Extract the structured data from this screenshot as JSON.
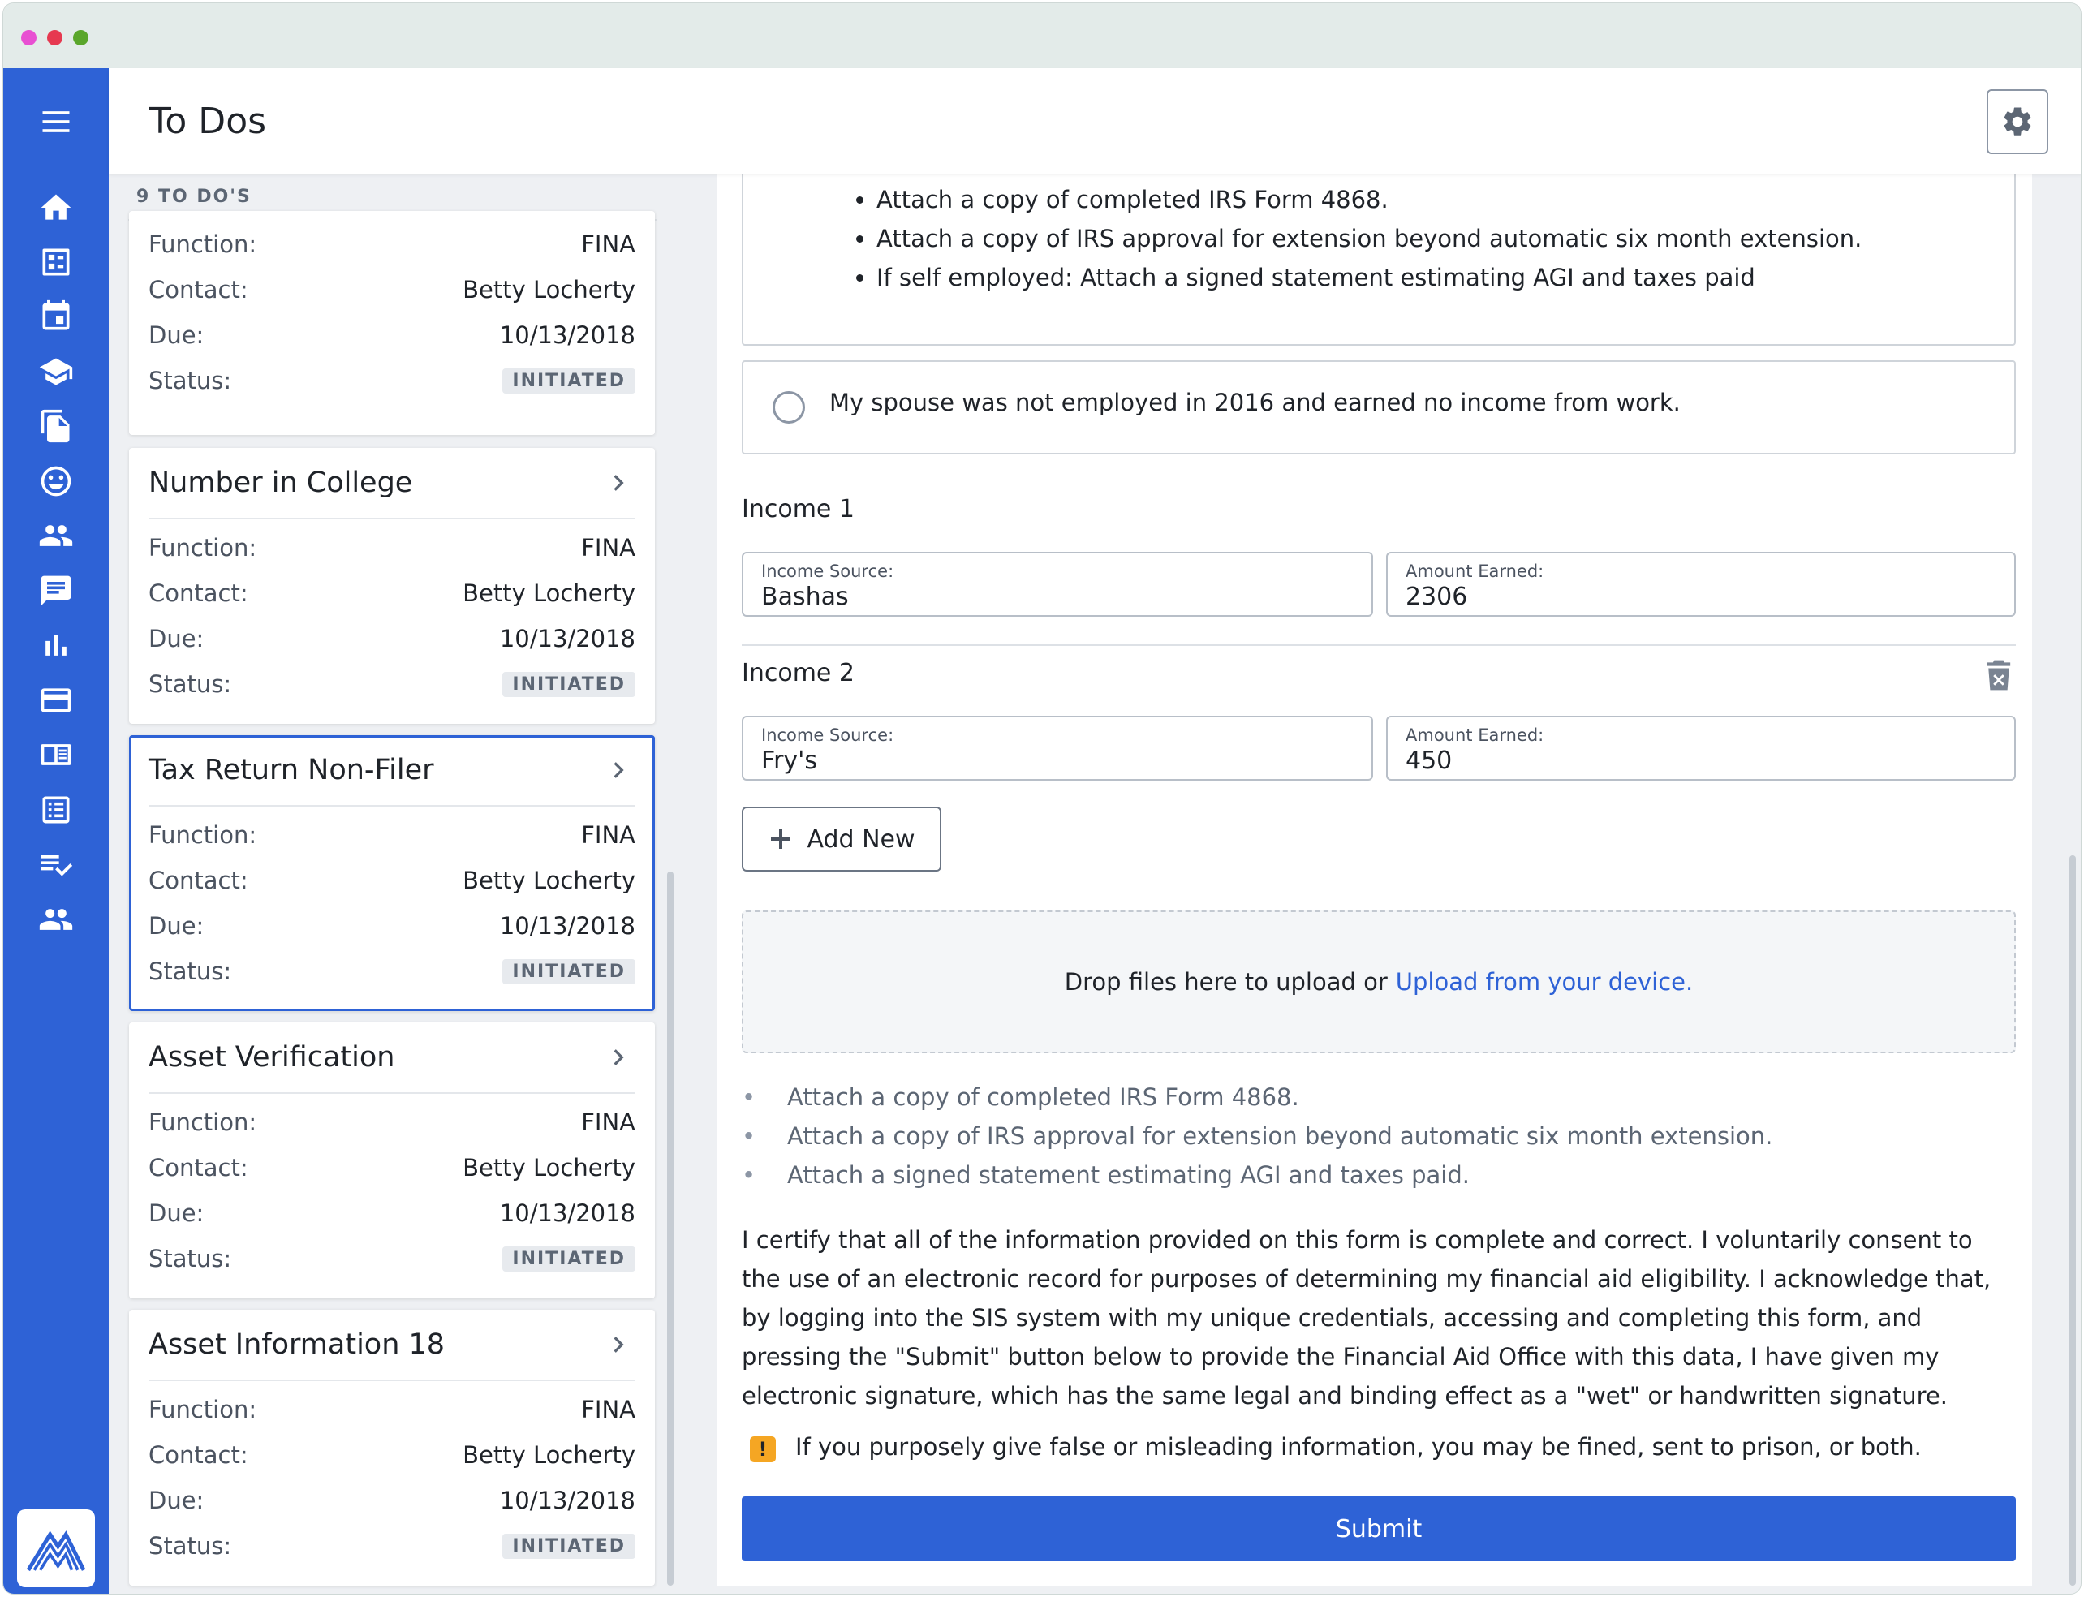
{
  "window": {
    "dots": [
      "#e84fd2",
      "#e63950",
      "#5aa62b"
    ]
  },
  "rail": {
    "icons": [
      "menu-icon",
      "home-icon",
      "dashboard-icon",
      "calendar-icon",
      "graduation-cap-icon",
      "documents-icon",
      "smiley-icon",
      "people-icon",
      "chat-icon",
      "bar-chart-icon",
      "credit-card-icon",
      "book-icon",
      "list-icon",
      "checklist-icon",
      "group-icon"
    ],
    "accent": "#2e62d6"
  },
  "header": {
    "title": "To Dos",
    "settings_icon": "gear-icon"
  },
  "list": {
    "count_label": "9 TO DO'S",
    "field_labels": {
      "function": "Function:",
      "contact": "Contact:",
      "due": "Due:",
      "status": "Status:"
    },
    "cards": [
      {
        "title": "",
        "function": "FINA",
        "contact": "Betty Locherty",
        "due": "10/13/2018",
        "status": "INITIATED"
      },
      {
        "title": "Number in College",
        "function": "FINA",
        "contact": "Betty Locherty",
        "due": "10/13/2018",
        "status": "INITIATED"
      },
      {
        "title": "Tax Return Non-Filer",
        "function": "FINA",
        "contact": "Betty Locherty",
        "due": "10/13/2018",
        "status": "INITIATED",
        "selected": true
      },
      {
        "title": "Asset Verification",
        "function": "FINA",
        "contact": "Betty Locherty",
        "due": "10/13/2018",
        "status": "INITIATED"
      },
      {
        "title": "Asset Information 18",
        "function": "FINA",
        "contact": "Betty Locherty",
        "due": "10/13/2018",
        "status": "INITIATED"
      }
    ]
  },
  "detail": {
    "option_bullets": [
      "Attach a copy of completed IRS Form 4868.",
      "Attach a copy of IRS approval for extension beyond automatic six month extension.",
      "If self employed: Attach a signed statement estimating AGI and taxes paid"
    ],
    "radio_option": "My spouse was not employed in 2016 and earned no income from work.",
    "incomes": [
      {
        "label": "Income 1",
        "source_label": "Income Source:",
        "source": "Bashas",
        "amount_label": "Amount Earned:",
        "amount": "2306"
      },
      {
        "label": "Income 2",
        "source_label": "Income Source:",
        "source": "Fry's",
        "amount_label": "Amount Earned:",
        "amount": "450"
      }
    ],
    "add_new_label": "Add New",
    "dropzone": {
      "text": "Drop files here to upload or",
      "link": "Upload from your device."
    },
    "requirements": [
      "Attach a copy of completed IRS Form 4868.",
      "Attach a copy of IRS approval for extension beyond automatic six month extension.",
      "Attach a signed statement estimating AGI and taxes paid."
    ],
    "certify_text": "I certify that all of the information provided on this form is complete and correct. I voluntarily consent to the use of an electronic record for purposes of determining my financial aid eligibility. I acknowledge that, by logging into the SIS system with my unique credentials, accessing and completing this form, and pressing the \"Submit\" button below to provide the Financial Aid Office with this data, I have given my electronic signature, which has the same legal and binding effect as a \"wet\" or handwritten signature.",
    "warning_icon_glyph": "!",
    "warning": "If you purposely give false or misleading information, you may be fined, sent to prison, or both.",
    "submit_label": "Submit"
  }
}
